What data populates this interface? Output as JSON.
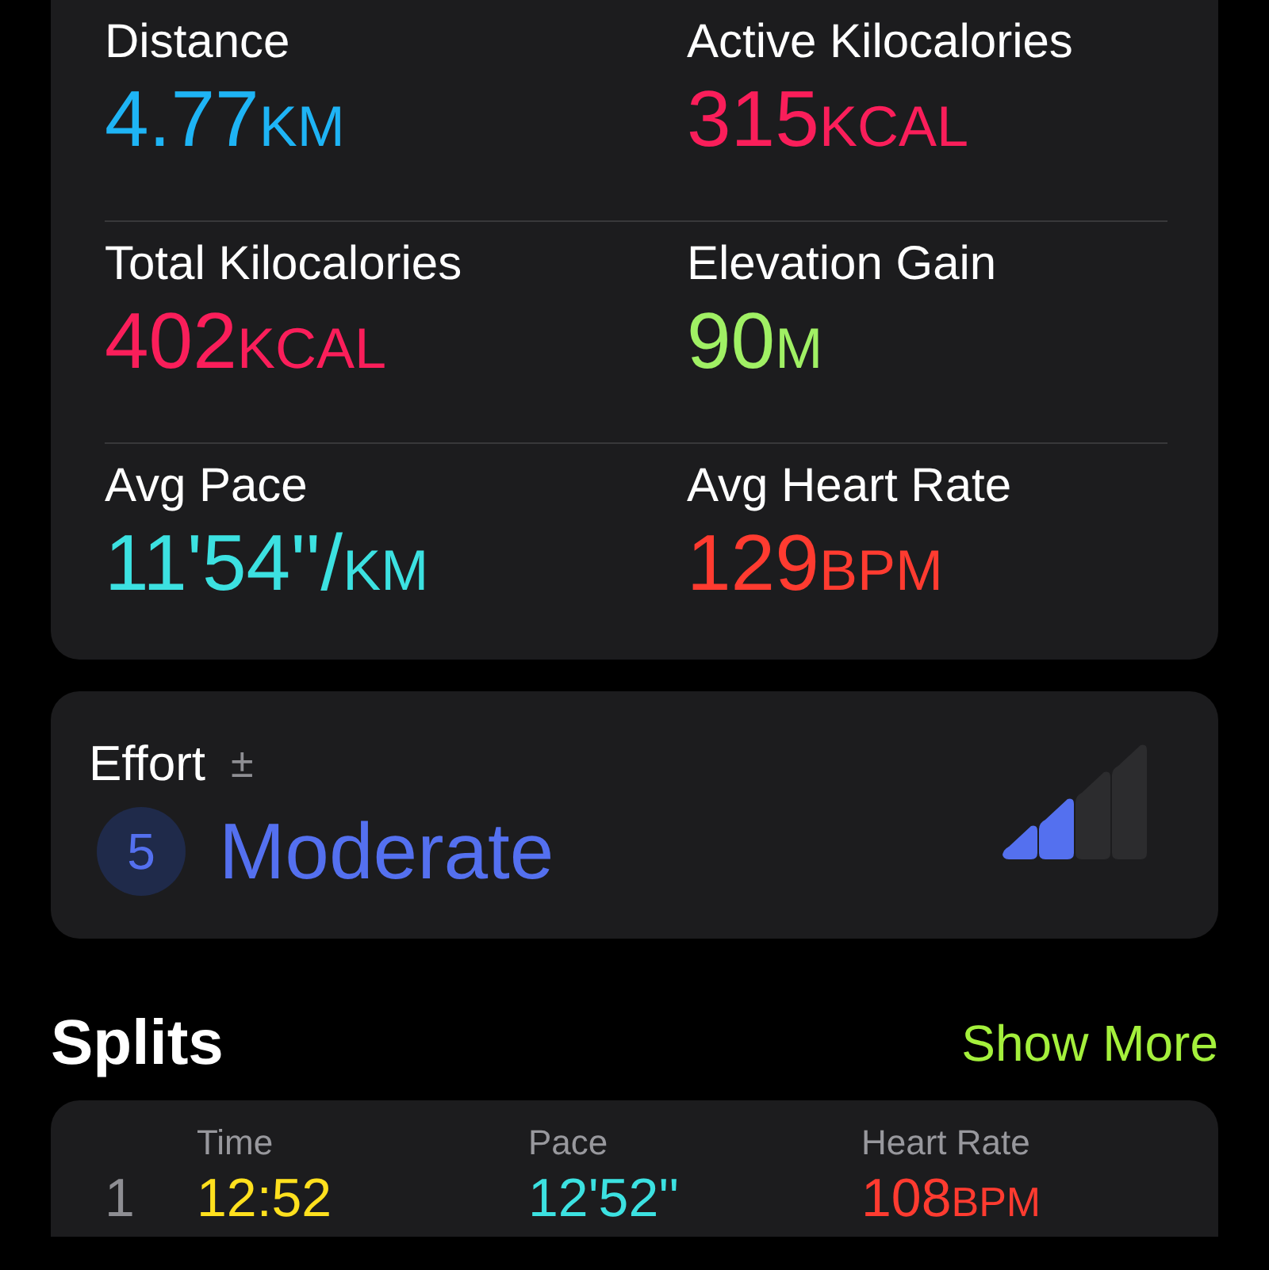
{
  "metrics": [
    {
      "label": "Distance",
      "value": "4.77",
      "unit": "KM",
      "color": "#1eb4f5"
    },
    {
      "label": "Active Kilocalories",
      "value": "315",
      "unit": "KCAL",
      "color": "#fa1e5a"
    },
    {
      "label": "Total Kilocalories",
      "value": "402",
      "unit": "KCAL",
      "color": "#fa1e5a"
    },
    {
      "label": "Elevation Gain",
      "value": "90",
      "unit": "M",
      "color": "#a0f064"
    },
    {
      "label": "Avg Pace",
      "value": "11'54''/",
      "unit": "KM",
      "color": "#3ce1e1"
    },
    {
      "label": "Avg Heart Rate",
      "value": "129",
      "unit": "BPM",
      "color": "#ff3b30"
    }
  ],
  "effort": {
    "label": "Effort",
    "adjust": "±",
    "score": "5",
    "rating": "Moderate",
    "level": 0.5
  },
  "splits": {
    "title": "Splits",
    "action": "Show More",
    "columns": [
      "Time",
      "Pace",
      "Heart Rate"
    ],
    "rows": [
      {
        "index": "1",
        "time": "12:52",
        "pace": "12'52''",
        "heart_rate": "108",
        "unit": "BPM"
      }
    ]
  }
}
